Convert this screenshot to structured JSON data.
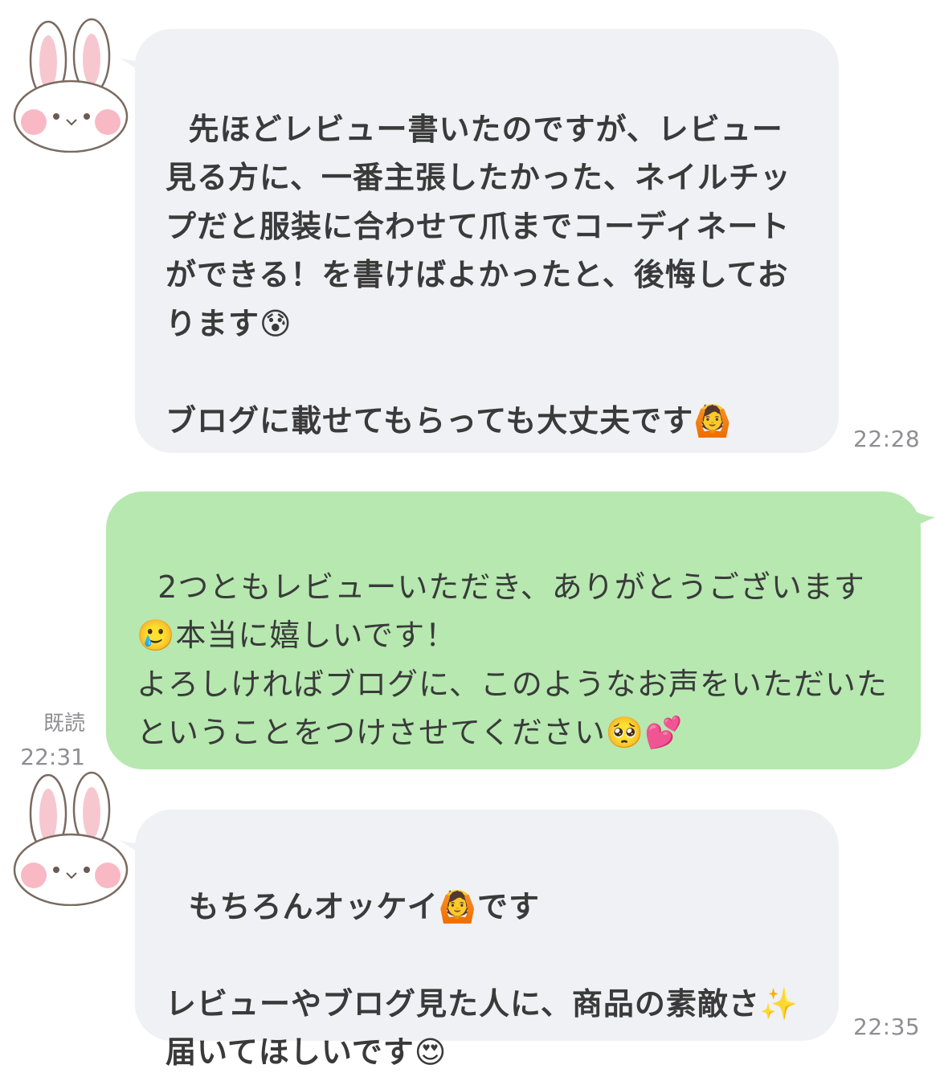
{
  "messages": [
    {
      "sender": "other",
      "text": "先ほどレビュー書いたのですが、レビュー見る方に、一番主張したかった、ネイルチップだと服装に合わせて爪までコーディネートができる！を書けばよかったと、後悔しております😰\n\nブログに載せてもらっても大丈夫です🙆",
      "time": "22:28"
    },
    {
      "sender": "me",
      "text": "2つともレビューいただき、ありがとうございます🥲本当に嬉しいです！\nよろしければブログに、このようなお声をいただいたということをつけさせてください🥺💕",
      "read_label": "既読",
      "time": "22:31"
    },
    {
      "sender": "other",
      "text": "もちろんオッケイ🙆です\n\nレビューやブログ見た人に、商品の素敵さ✨届いてほしいです😍",
      "time": "22:35"
    }
  ],
  "colors": {
    "incoming_bubble": "#f0f1f5",
    "outgoing_bubble": "#b6e8b0",
    "timestamp": "#8e8e93"
  },
  "icons": {
    "avatar": "bunny-avatar-icon"
  }
}
